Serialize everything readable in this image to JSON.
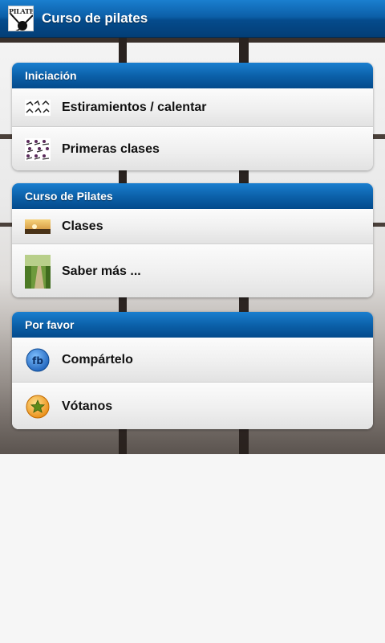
{
  "header": {
    "title": "Curso de pilates",
    "logo_text": "PILATES"
  },
  "groups": [
    {
      "title": "Iniciación",
      "items": [
        {
          "label": "Estiramientos / calentar",
          "icon": "stretching-figures-icon"
        },
        {
          "label": "Primeras clases",
          "icon": "exercise-figures-icon"
        }
      ]
    },
    {
      "title": "Curso de Pilates",
      "items": [
        {
          "label": "Clases",
          "icon": "sunset-photo-icon"
        },
        {
          "label": "Saber más ...",
          "icon": "path-photo-icon"
        }
      ]
    },
    {
      "title": "Por favor",
      "items": [
        {
          "label": "Compártelo",
          "icon": "facebook-icon",
          "icon_text": "fb"
        },
        {
          "label": "Vótanos",
          "icon": "star-rate-icon"
        }
      ]
    }
  ],
  "colors": {
    "header_blue": "#0c5fa8",
    "fb_blue": "#2d7fd6",
    "star_orange": "#f5a623"
  }
}
